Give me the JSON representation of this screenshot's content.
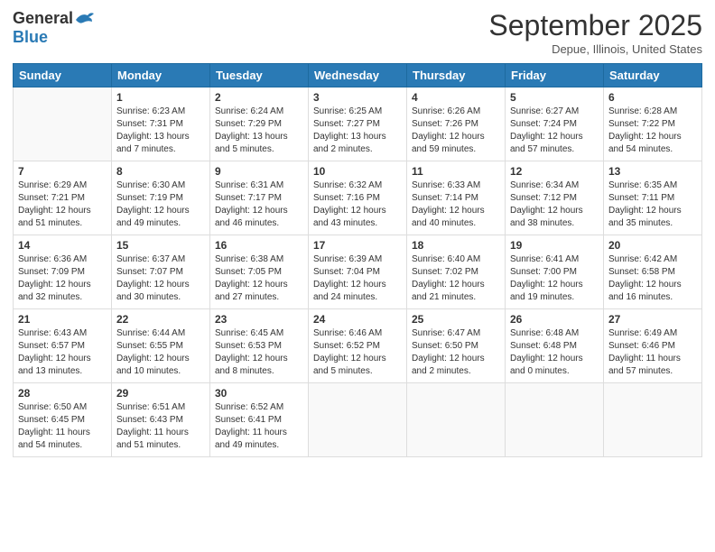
{
  "header": {
    "logo_general": "General",
    "logo_blue": "Blue",
    "month_title": "September 2025",
    "subtitle": "Depue, Illinois, United States"
  },
  "days_of_week": [
    "Sunday",
    "Monday",
    "Tuesday",
    "Wednesday",
    "Thursday",
    "Friday",
    "Saturday"
  ],
  "weeks": [
    [
      {
        "day": "",
        "info": ""
      },
      {
        "day": "1",
        "info": "Sunrise: 6:23 AM\nSunset: 7:31 PM\nDaylight: 13 hours\nand 7 minutes."
      },
      {
        "day": "2",
        "info": "Sunrise: 6:24 AM\nSunset: 7:29 PM\nDaylight: 13 hours\nand 5 minutes."
      },
      {
        "day": "3",
        "info": "Sunrise: 6:25 AM\nSunset: 7:27 PM\nDaylight: 13 hours\nand 2 minutes."
      },
      {
        "day": "4",
        "info": "Sunrise: 6:26 AM\nSunset: 7:26 PM\nDaylight: 12 hours\nand 59 minutes."
      },
      {
        "day": "5",
        "info": "Sunrise: 6:27 AM\nSunset: 7:24 PM\nDaylight: 12 hours\nand 57 minutes."
      },
      {
        "day": "6",
        "info": "Sunrise: 6:28 AM\nSunset: 7:22 PM\nDaylight: 12 hours\nand 54 minutes."
      }
    ],
    [
      {
        "day": "7",
        "info": "Sunrise: 6:29 AM\nSunset: 7:21 PM\nDaylight: 12 hours\nand 51 minutes."
      },
      {
        "day": "8",
        "info": "Sunrise: 6:30 AM\nSunset: 7:19 PM\nDaylight: 12 hours\nand 49 minutes."
      },
      {
        "day": "9",
        "info": "Sunrise: 6:31 AM\nSunset: 7:17 PM\nDaylight: 12 hours\nand 46 minutes."
      },
      {
        "day": "10",
        "info": "Sunrise: 6:32 AM\nSunset: 7:16 PM\nDaylight: 12 hours\nand 43 minutes."
      },
      {
        "day": "11",
        "info": "Sunrise: 6:33 AM\nSunset: 7:14 PM\nDaylight: 12 hours\nand 40 minutes."
      },
      {
        "day": "12",
        "info": "Sunrise: 6:34 AM\nSunset: 7:12 PM\nDaylight: 12 hours\nand 38 minutes."
      },
      {
        "day": "13",
        "info": "Sunrise: 6:35 AM\nSunset: 7:11 PM\nDaylight: 12 hours\nand 35 minutes."
      }
    ],
    [
      {
        "day": "14",
        "info": "Sunrise: 6:36 AM\nSunset: 7:09 PM\nDaylight: 12 hours\nand 32 minutes."
      },
      {
        "day": "15",
        "info": "Sunrise: 6:37 AM\nSunset: 7:07 PM\nDaylight: 12 hours\nand 30 minutes."
      },
      {
        "day": "16",
        "info": "Sunrise: 6:38 AM\nSunset: 7:05 PM\nDaylight: 12 hours\nand 27 minutes."
      },
      {
        "day": "17",
        "info": "Sunrise: 6:39 AM\nSunset: 7:04 PM\nDaylight: 12 hours\nand 24 minutes."
      },
      {
        "day": "18",
        "info": "Sunrise: 6:40 AM\nSunset: 7:02 PM\nDaylight: 12 hours\nand 21 minutes."
      },
      {
        "day": "19",
        "info": "Sunrise: 6:41 AM\nSunset: 7:00 PM\nDaylight: 12 hours\nand 19 minutes."
      },
      {
        "day": "20",
        "info": "Sunrise: 6:42 AM\nSunset: 6:58 PM\nDaylight: 12 hours\nand 16 minutes."
      }
    ],
    [
      {
        "day": "21",
        "info": "Sunrise: 6:43 AM\nSunset: 6:57 PM\nDaylight: 12 hours\nand 13 minutes."
      },
      {
        "day": "22",
        "info": "Sunrise: 6:44 AM\nSunset: 6:55 PM\nDaylight: 12 hours\nand 10 minutes."
      },
      {
        "day": "23",
        "info": "Sunrise: 6:45 AM\nSunset: 6:53 PM\nDaylight: 12 hours\nand 8 minutes."
      },
      {
        "day": "24",
        "info": "Sunrise: 6:46 AM\nSunset: 6:52 PM\nDaylight: 12 hours\nand 5 minutes."
      },
      {
        "day": "25",
        "info": "Sunrise: 6:47 AM\nSunset: 6:50 PM\nDaylight: 12 hours\nand 2 minutes."
      },
      {
        "day": "26",
        "info": "Sunrise: 6:48 AM\nSunset: 6:48 PM\nDaylight: 12 hours\nand 0 minutes."
      },
      {
        "day": "27",
        "info": "Sunrise: 6:49 AM\nSunset: 6:46 PM\nDaylight: 11 hours\nand 57 minutes."
      }
    ],
    [
      {
        "day": "28",
        "info": "Sunrise: 6:50 AM\nSunset: 6:45 PM\nDaylight: 11 hours\nand 54 minutes."
      },
      {
        "day": "29",
        "info": "Sunrise: 6:51 AM\nSunset: 6:43 PM\nDaylight: 11 hours\nand 51 minutes."
      },
      {
        "day": "30",
        "info": "Sunrise: 6:52 AM\nSunset: 6:41 PM\nDaylight: 11 hours\nand 49 minutes."
      },
      {
        "day": "",
        "info": ""
      },
      {
        "day": "",
        "info": ""
      },
      {
        "day": "",
        "info": ""
      },
      {
        "day": "",
        "info": ""
      }
    ]
  ]
}
